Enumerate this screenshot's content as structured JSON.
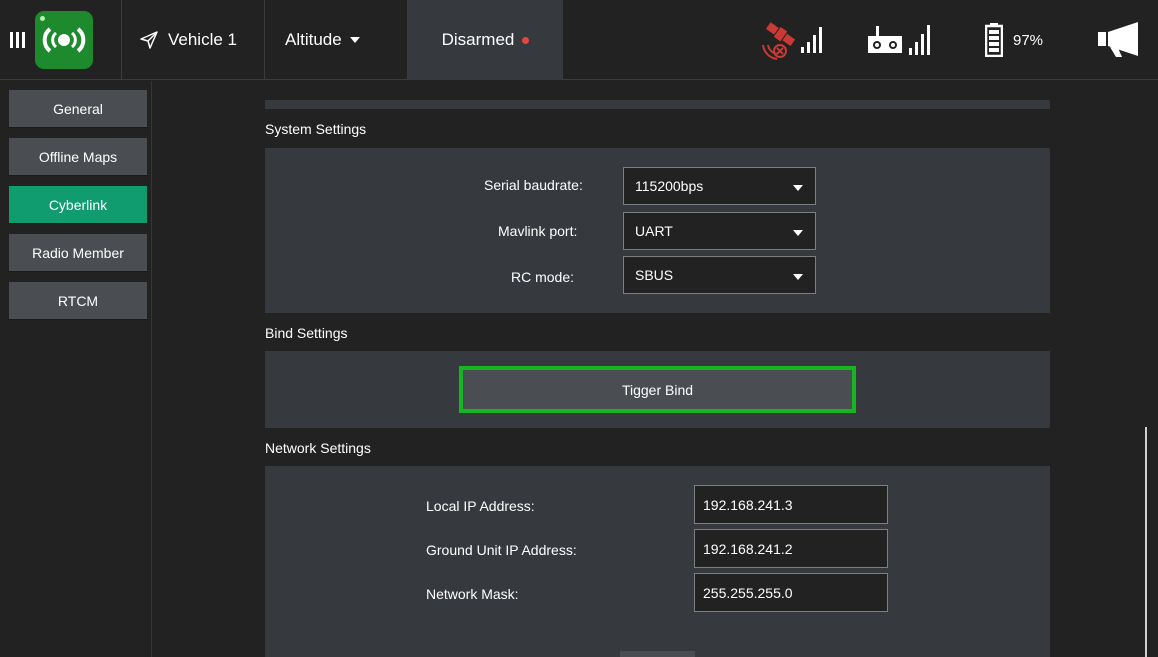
{
  "toolbar": {
    "vehicle_label": "Vehicle 1",
    "flight_mode": "Altitude",
    "arm_status": "Disarmed",
    "battery_percent": "97%",
    "icons": [
      "menu-icon",
      "app-logo-icon",
      "paper-plane-icon",
      "gps-satellite-icon",
      "signal-bars-icon",
      "rc-transmitter-icon",
      "battery-icon",
      "megaphone-icon"
    ],
    "colors": {
      "armed_dot": "#e8443a",
      "gps_warning": "#c93a36",
      "logo_bg": "#1d8a2e"
    }
  },
  "nav": {
    "items": [
      {
        "label": "General",
        "active": false
      },
      {
        "label": "Offline Maps",
        "active": false
      },
      {
        "label": "Cyberlink",
        "active": true
      },
      {
        "label": "Radio Member",
        "active": false
      },
      {
        "label": "RTCM",
        "active": false
      }
    ],
    "active_color": "#119c70"
  },
  "system": {
    "title": "System Settings",
    "baudrate_label": "Serial baudrate:",
    "baudrate_value": "115200bps",
    "mavlink_label": "Mavlink port:",
    "mavlink_value": "UART",
    "rc_label": "RC mode:",
    "rc_value": "SBUS"
  },
  "bind": {
    "title": "Bind Settings",
    "button_label": "Tigger Bind",
    "highlight_color": "#17b521"
  },
  "network": {
    "title": "Network Settings",
    "local_ip_label": "Local IP Address:",
    "local_ip_value": "192.168.241.3",
    "ground_ip_label": "Ground Unit IP Address:",
    "ground_ip_value": "192.168.241.2",
    "mask_label": "Network Mask:",
    "mask_value": "255.255.255.0"
  }
}
